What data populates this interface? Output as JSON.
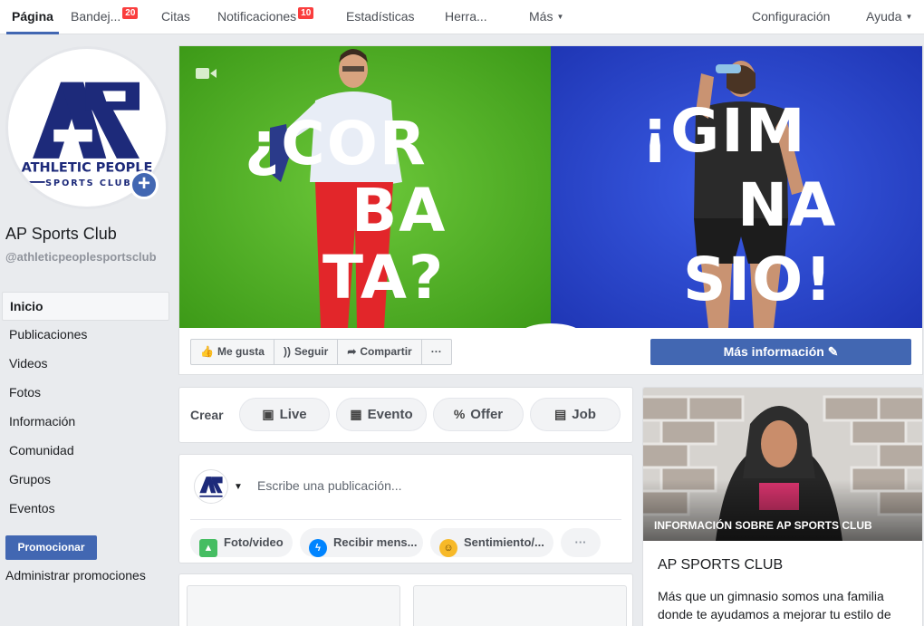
{
  "nav": {
    "items": [
      {
        "label": "Página",
        "badge": null
      },
      {
        "label": "Bandej...",
        "badge": "20"
      },
      {
        "label": "Citas",
        "badge": null
      },
      {
        "label": "Notificaciones",
        "badge": "10"
      },
      {
        "label": "Estadísticas",
        "badge": null
      },
      {
        "label": "Herra...",
        "badge": null
      },
      {
        "label": "Más",
        "badge": null
      },
      {
        "label": "Configuración",
        "badge": null
      },
      {
        "label": "Ayuda",
        "badge": null
      }
    ]
  },
  "profile": {
    "logo_text_main": "ATHLETIC PEOPLE",
    "logo_text_sub": "SPORTS CLUB",
    "name": "AP Sports Club",
    "handle": "@athleticpeoplesportsclub"
  },
  "leftnav": {
    "items": [
      "Inicio",
      "Publicaciones",
      "Videos",
      "Fotos",
      "Información",
      "Comunidad",
      "Grupos",
      "Eventos"
    ]
  },
  "promote": {
    "button": "Promocionar",
    "manage": "Administrar promociones"
  },
  "cover": {
    "left_text": [
      "¿COR",
      "BA",
      "TA?"
    ],
    "right_text": [
      "¡GIM",
      "NA",
      "SIO!"
    ],
    "left_color": "#4fb322",
    "right_color": "#2c49d1"
  },
  "actions": {
    "like": "Me gusta",
    "follow": "Seguir",
    "share": "Compartir",
    "more": "···",
    "more_info": "Más información"
  },
  "create": {
    "label": "Crear",
    "buttons": [
      "Live",
      "Evento",
      "Offer",
      "Job"
    ]
  },
  "post": {
    "placeholder": "Escribe una publicación...",
    "buttons": [
      "Foto/video",
      "Recibir mens...",
      "Sentimiento/...",
      "···"
    ]
  },
  "about": {
    "overlay": "INFORMACIÓN SOBRE AP SPORTS CLUB",
    "title": "AP SPORTS CLUB",
    "description": "Más que un gimnasio somos una familia donde te ayudamos a mejorar tu estilo de vida"
  },
  "colors": {
    "brand_blue": "#4267b2",
    "badge_red": "#fa3e3e",
    "logo_navy": "#1d2a7a"
  }
}
